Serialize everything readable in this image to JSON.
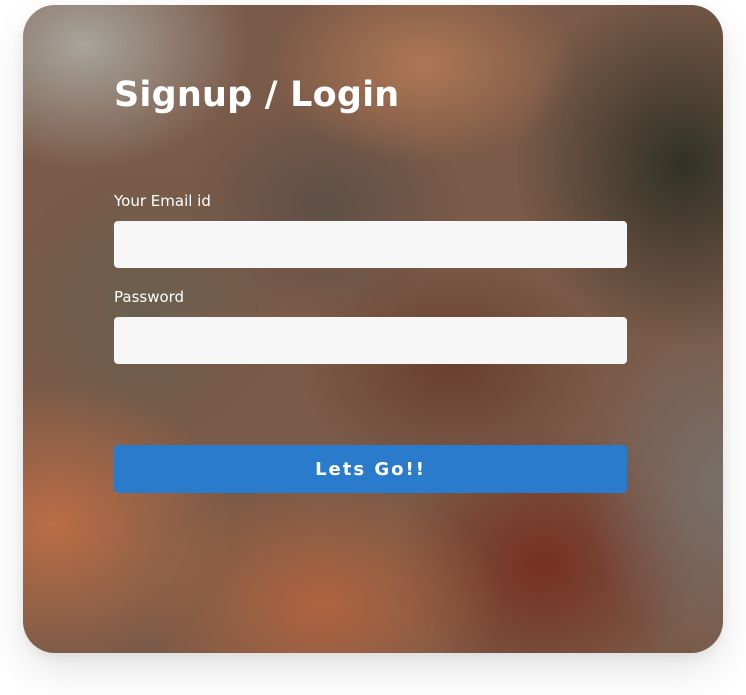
{
  "form": {
    "title": "Signup / Login",
    "email_label": "Your Email id",
    "email_value": "",
    "password_label": "Password",
    "password_value": "",
    "submit_label": "Lets Go!!"
  },
  "colors": {
    "button": "#2a7bcb",
    "input_background": "#f7f7f7",
    "text": "#ffffff"
  }
}
